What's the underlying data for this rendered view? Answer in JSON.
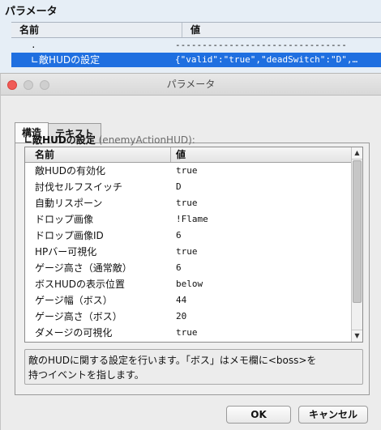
{
  "outer": {
    "title": "パラメータ",
    "col_name": "名前",
    "col_value": "値",
    "rows": [
      {
        "name": ".",
        "value": "--------------------------------"
      },
      {
        "name": "∟敵HUDの設定",
        "value": "{\"valid\":\"true\",\"deadSwitch\":\"D\",…"
      }
    ]
  },
  "dialog": {
    "title": "パラメータ",
    "tabs": [
      "構造",
      "テキスト"
    ],
    "section_label": "∟敵HUDの設定",
    "section_sub": " (enemyActionHUD):",
    "col_name": "名前",
    "col_value": "値",
    "rows": [
      {
        "name": "敵HUDの有効化",
        "value": "true"
      },
      {
        "name": "討伐セルフスイッチ",
        "value": "D"
      },
      {
        "name": "自動リスポーン",
        "value": "true"
      },
      {
        "name": "ドロップ画像",
        "value": "!Flame"
      },
      {
        "name": "ドロップ画像ID",
        "value": "6"
      },
      {
        "name": "HPバー可視化",
        "value": "true"
      },
      {
        "name": "ゲージ高さ（通常敵）",
        "value": "6"
      },
      {
        "name": "ボスHUDの表示位置",
        "value": "below"
      },
      {
        "name": "ゲージ幅（ボス）",
        "value": "44"
      },
      {
        "name": "ゲージ高さ（ボス）",
        "value": "20"
      },
      {
        "name": "ダメージの可視化",
        "value": "true"
      }
    ],
    "description_line1": "敵のHUDに関する設定を行います。「ボス」はメモ欄に<boss>を",
    "description_line2": "持つイベントを指します。",
    "ok_label": "OK",
    "cancel_label": "キャンセル"
  },
  "colors": {
    "selection": "#1f6fe0",
    "close_button": "#f05b57"
  }
}
